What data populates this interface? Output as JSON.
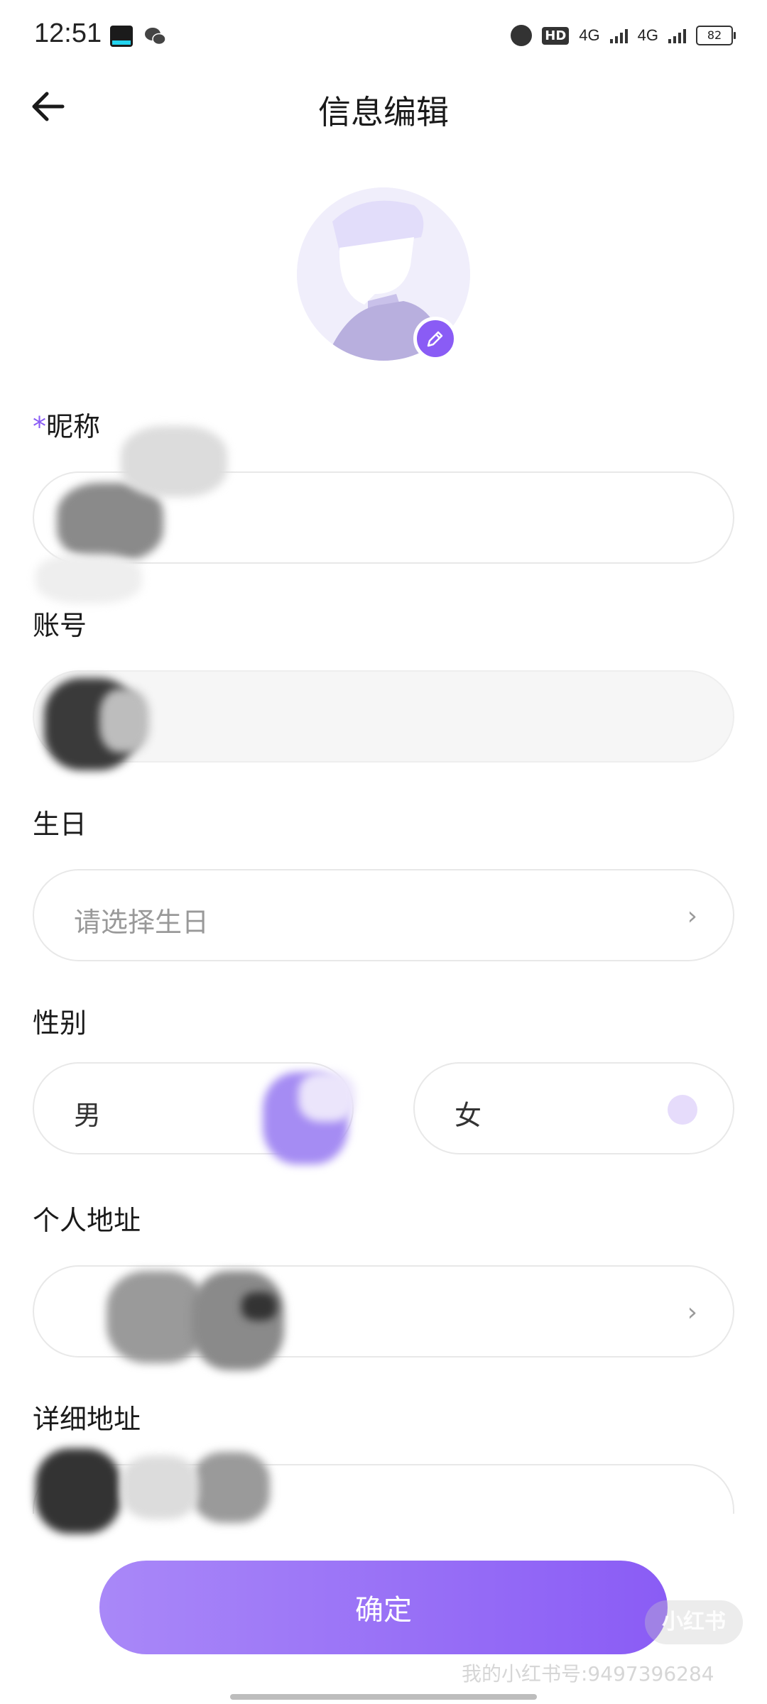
{
  "status_bar": {
    "time": "12:51",
    "hd_label": "HD",
    "sim1_label": "4G",
    "sim2_label": "4G",
    "battery": "82"
  },
  "header": {
    "title": "信息编辑",
    "back_icon": "arrow-left-icon"
  },
  "avatar": {
    "edit_icon": "pencil-icon",
    "accent": "#8a5cf5"
  },
  "form": {
    "nickname": {
      "required_mark": "*",
      "label": "昵称",
      "value": ""
    },
    "account": {
      "label": "账号",
      "value": ""
    },
    "birthday": {
      "label": "生日",
      "placeholder": "请选择生日"
    },
    "gender": {
      "label": "性别",
      "options": [
        "男",
        "女"
      ]
    },
    "address": {
      "label": "个人地址",
      "value": ""
    },
    "detail_address": {
      "label": "详细地址",
      "value": ""
    }
  },
  "actions": {
    "confirm_label": "确定"
  },
  "watermark": {
    "badge": "小红书",
    "text": "我的小红书号:9497396284"
  }
}
